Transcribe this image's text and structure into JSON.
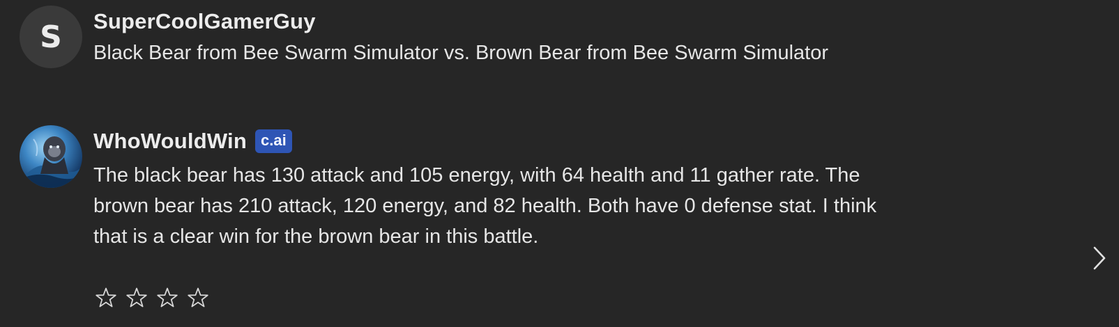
{
  "user_message": {
    "avatar_letter": "S",
    "name": "SuperCoolGamerGuy",
    "text": "Black Bear from Bee Swarm Simulator vs. Brown Bear from Bee Swarm Simulator"
  },
  "bot_message": {
    "avatar_icon": "character-portrait",
    "name": "WhoWouldWin",
    "badge": "c.ai",
    "text": "The black bear has 130 attack and 105 energy, with 64 health and 11 gather rate. The brown bear has 210 attack, 120 energy, and 82 health. Both have 0 defense stat. I think that is a clear win for the brown bear in this battle."
  },
  "rating": {
    "stars": 4,
    "filled": 0,
    "icon": "star-outline-icon"
  },
  "navigation": {
    "next_icon": "chevron-right-icon"
  },
  "colors": {
    "background": "#262626",
    "badge": "#2e55b5",
    "user_avatar_bg": "#3a3a3a",
    "text": "#e6e6e6"
  }
}
